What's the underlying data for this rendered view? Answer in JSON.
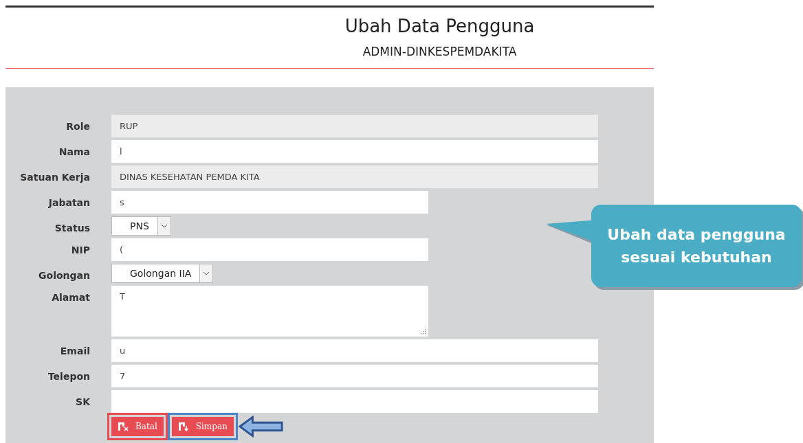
{
  "header": {
    "title": "Ubah Data Pengguna",
    "subtitle": "ADMIN-DINKESPEMDAKITA"
  },
  "fields": [
    {
      "label": "Role",
      "kind": "readonly",
      "value": "RUP"
    },
    {
      "label": "Nama",
      "kind": "text",
      "value": "l"
    },
    {
      "label": "Satuan Kerja",
      "kind": "readonly",
      "value": "DINAS KESEHATAN PEMDA KITA"
    },
    {
      "label": "Jabatan",
      "kind": "text",
      "value": "s"
    },
    {
      "label": "Status",
      "kind": "select",
      "value": "PNS"
    },
    {
      "label": "NIP",
      "kind": "text",
      "value": "("
    },
    {
      "label": "Golongan",
      "kind": "select",
      "value": "Golongan IIA"
    },
    {
      "label": "Alamat",
      "kind": "textarea",
      "value": "T"
    },
    {
      "label": "Email",
      "kind": "text",
      "value": "u"
    },
    {
      "label": "Telepon",
      "kind": "text",
      "value": "7"
    },
    {
      "label": "SK",
      "kind": "text"
    }
  ],
  "buttons": [
    {
      "label": "Batal",
      "kind": "cancel",
      "highlighted": false
    },
    {
      "label": "Simpan",
      "kind": "save",
      "highlighted": true
    }
  ],
  "callout": {
    "text": "Ubah data pengguna sesuai kebutuhan"
  }
}
